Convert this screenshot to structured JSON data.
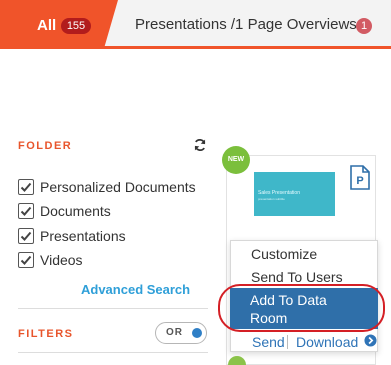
{
  "tabs": [
    {
      "label": "All",
      "count": "155",
      "active": true
    },
    {
      "label": "Presentations /1 Page Overviews",
      "count": "1",
      "active": false
    }
  ],
  "colors": {
    "accent": "#f0542a",
    "link": "#2f74b7",
    "highlight": "#2f6fa9",
    "ring": "#d41f25",
    "new_badge": "#7bbf3c"
  },
  "folder": {
    "title": "FOLDER",
    "refresh_icon": "refresh-icon",
    "items": [
      {
        "label": "Personalized Documents",
        "checked": true
      },
      {
        "label": "Documents",
        "checked": true
      },
      {
        "label": "Presentations",
        "checked": true
      },
      {
        "label": "Videos",
        "checked": true
      }
    ],
    "advanced_search": "Advanced Search"
  },
  "filters": {
    "title": "FILTERS",
    "toggle_label": "OR"
  },
  "card": {
    "badge": "NEW",
    "thumbnail_title": "Sales Presentation",
    "thumbnail_subtitle": "presentation subtitle",
    "file_icon": "powerpoint-icon"
  },
  "context_menu": {
    "items": [
      "Customize",
      "Send To Users"
    ],
    "highlighted_line1": "Add To Data",
    "highlighted_line2": "Room"
  },
  "actions": {
    "send": "Send",
    "download": "Download",
    "download_icon": "chevron-right-circle-icon"
  }
}
